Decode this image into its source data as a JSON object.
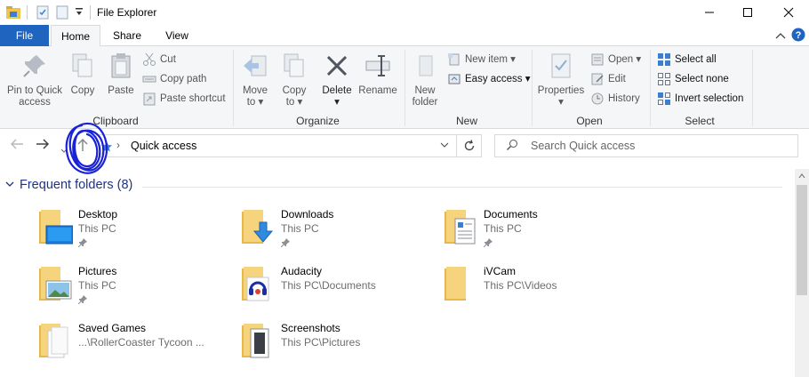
{
  "window": {
    "title": "File Explorer"
  },
  "ribbon_tabs": [
    {
      "label": "File"
    },
    {
      "label": "Home"
    },
    {
      "label": "Share"
    },
    {
      "label": "View"
    }
  ],
  "clipboard": {
    "pin_label_1": "Pin to Quick",
    "pin_label_2": "access",
    "copy": "Copy",
    "paste": "Paste",
    "cut": "Cut",
    "copy_path": "Copy path",
    "paste_shortcut": "Paste shortcut",
    "group": "Clipboard"
  },
  "organize": {
    "move_to_1": "Move",
    "move_to_2": "to",
    "copy_to_1": "Copy",
    "copy_to_2": "to",
    "delete": "Delete",
    "rename": "Rename",
    "group": "Organize"
  },
  "new": {
    "new_folder_1": "New",
    "new_folder_2": "folder",
    "new_item": "New item",
    "easy_access": "Easy access",
    "group": "New"
  },
  "open": {
    "properties": "Properties",
    "open": "Open",
    "edit": "Edit",
    "history": "History",
    "group": "Open"
  },
  "select": {
    "select_all": "Select all",
    "select_none": "Select none",
    "invert": "Invert selection",
    "group": "Select"
  },
  "address": {
    "path": "Quick access",
    "search_placeholder": "Search Quick access"
  },
  "frequent": {
    "header": "Frequent folders (8)",
    "items": [
      {
        "name": "Desktop",
        "location": "This PC",
        "pinned": true
      },
      {
        "name": "Downloads",
        "location": "This PC",
        "pinned": true
      },
      {
        "name": "Documents",
        "location": "This PC",
        "pinned": true
      },
      {
        "name": "Pictures",
        "location": "This PC",
        "pinned": true
      },
      {
        "name": "Audacity",
        "location": "This PC\\Documents",
        "pinned": false
      },
      {
        "name": "iVCam",
        "location": "This PC\\Videos",
        "pinned": false
      },
      {
        "name": "Saved Games",
        "location": "...\\RollerCoaster Tycoon ...",
        "pinned": false
      },
      {
        "name": "Screenshots",
        "location": "This PC\\Pictures",
        "pinned": false
      }
    ]
  },
  "colors": {
    "file_tab": "#1f65c0",
    "folder": "#f0c453",
    "header_text": "#1e3287",
    "annotation": "#1a22d6"
  }
}
